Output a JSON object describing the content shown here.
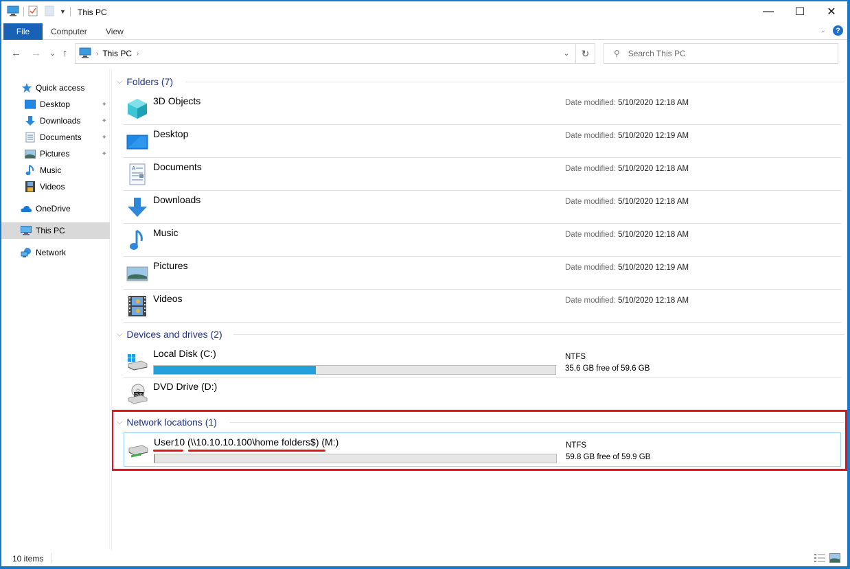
{
  "window": {
    "title": "This PC",
    "controls": {
      "minimize": "—",
      "maximize": "☐",
      "close": "✕"
    }
  },
  "ribbon": {
    "tabs": [
      {
        "label": "File"
      },
      {
        "label": "Computer"
      },
      {
        "label": "View"
      }
    ],
    "help_glyph": "?"
  },
  "navigation": {
    "back": "←",
    "forward": "→",
    "recent": "⌄",
    "up": "↑",
    "breadcrumb": [
      "This PC"
    ],
    "refresh": "↻",
    "search_placeholder": "Search This PC"
  },
  "sidebar": {
    "items": [
      {
        "label": "Quick access",
        "icon": "star-icon",
        "pinned": false
      },
      {
        "label": "Desktop",
        "icon": "desktop-icon",
        "pinned": true
      },
      {
        "label": "Downloads",
        "icon": "download-icon",
        "pinned": true
      },
      {
        "label": "Documents",
        "icon": "document-icon",
        "pinned": true
      },
      {
        "label": "Pictures",
        "icon": "picture-icon",
        "pinned": true
      },
      {
        "label": "Music",
        "icon": "music-icon",
        "pinned": false
      },
      {
        "label": "Videos",
        "icon": "video-icon",
        "pinned": false
      },
      {
        "label": "OneDrive",
        "icon": "cloud-icon",
        "pinned": false
      },
      {
        "label": "This PC",
        "icon": "computer-icon",
        "pinned": false,
        "selected": true
      },
      {
        "label": "Network",
        "icon": "network-icon",
        "pinned": false
      }
    ],
    "pin_glyph": "📌"
  },
  "content": {
    "groups": {
      "folders": {
        "title": "Folders (7)",
        "items": [
          {
            "name": "3D Objects",
            "date_label": "Date modified:",
            "date": "5/10/2020 12:18 AM",
            "icon": "3d-objects-icon"
          },
          {
            "name": "Desktop",
            "date_label": "Date modified:",
            "date": "5/10/2020 12:19 AM",
            "icon": "desktop-icon"
          },
          {
            "name": "Documents",
            "date_label": "Date modified:",
            "date": "5/10/2020 12:18 AM",
            "icon": "document-icon"
          },
          {
            "name": "Downloads",
            "date_label": "Date modified:",
            "date": "5/10/2020 12:18 AM",
            "icon": "download-icon"
          },
          {
            "name": "Music",
            "date_label": "Date modified:",
            "date": "5/10/2020 12:18 AM",
            "icon": "music-icon"
          },
          {
            "name": "Pictures",
            "date_label": "Date modified:",
            "date": "5/10/2020 12:19 AM",
            "icon": "picture-icon"
          },
          {
            "name": "Videos",
            "date_label": "Date modified:",
            "date": "5/10/2020 12:18 AM",
            "icon": "video-icon"
          }
        ]
      },
      "devices": {
        "title": "Devices and drives (2)",
        "items": [
          {
            "name": "Local Disk (C:)",
            "filesystem": "NTFS",
            "free_text": "35.6 GB free of 59.6 GB",
            "used_fraction": 0.403,
            "icon": "local-disk-icon"
          },
          {
            "name": "DVD Drive (D:)",
            "icon": "dvd-drive-icon"
          }
        ]
      },
      "network": {
        "title": "Network locations (1)",
        "items": [
          {
            "name": "User10 (\\\\10.10.10.100\\home folders$) (M:)",
            "filesystem": "NTFS",
            "free_text": "59.8 GB free of 59.9 GB",
            "used_fraction": 0.002,
            "icon": "network-drive-icon"
          }
        ]
      }
    }
  },
  "annotation": {
    "highlight_color": "#e1121c"
  },
  "status": {
    "item_count": "10 items"
  },
  "colors": {
    "accent": "#1961b5",
    "bar_fill": "#26a0da",
    "group_header": "#1e3287"
  }
}
